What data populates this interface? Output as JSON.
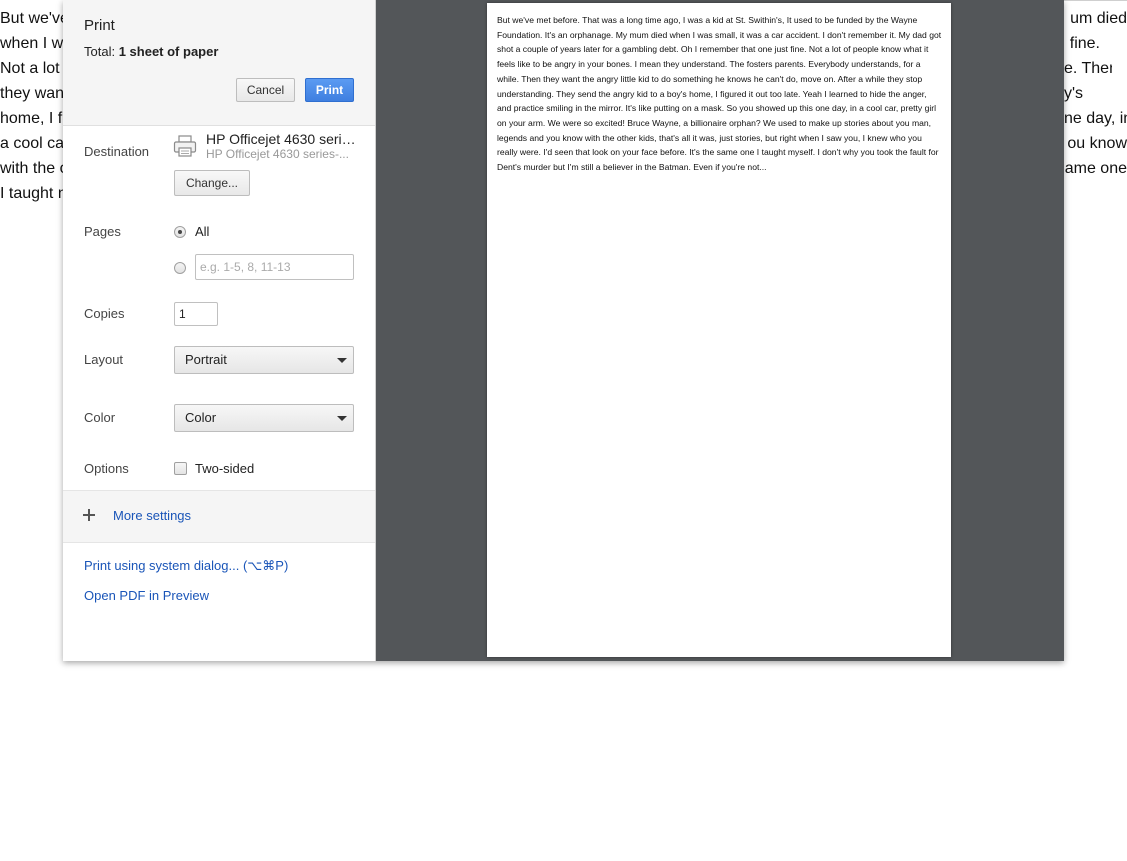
{
  "background_page": {
    "left_lines": [
      "But we've",
      "when I wa",
      "Not a lot",
      "they wan",
      "home, I fi",
      "a cool ca",
      "with the o",
      "I taught n"
    ],
    "right_lines": [
      "um died",
      "fine.",
      "e. Then",
      "y's",
      "ne day, in",
      "ou know",
      "ame one",
      ""
    ]
  },
  "dialog": {
    "title": "Print",
    "total_label": "Total:",
    "total_value": "1 sheet of paper",
    "cancel_label": "Cancel",
    "print_label": "Print",
    "destination": {
      "label": "Destination",
      "printer_name": "HP Officejet 4630 serie...",
      "printer_sub": "HP Officejet 4630 series-...",
      "change_label": "Change...",
      "icon": "printer-icon"
    },
    "pages": {
      "label": "Pages",
      "all_label": "All",
      "all_selected": true,
      "custom_placeholder": "e.g. 1-5, 8, 11-13"
    },
    "copies": {
      "label": "Copies",
      "value": "1"
    },
    "layout": {
      "label": "Layout",
      "selected": "Portrait"
    },
    "color": {
      "label": "Color",
      "selected": "Color"
    },
    "options": {
      "label": "Options",
      "two_sided_label": "Two-sided",
      "two_sided_checked": false
    },
    "more_settings_label": "More settings",
    "system_dialog_link": "Print using system dialog... (⌥⌘P)",
    "open_pdf_link": "Open PDF in Preview"
  },
  "preview": {
    "text": "But we've met before. That was a long time ago, I was a kid at St. Swithin's, It used to be funded by the Wayne Foundation. It's an orphanage. My mum died when I was small, it was a car accident. I don't remember it. My dad got shot a couple of years later for a gambling debt. Oh I remember that one just fine. Not a lot of people know what it feels like to be angry in your bones. I mean they understand. The fosters parents. Everybody understands, for a while. Then they want the angry little kid to do something he knows he can't do, move on. After a while they stop understanding. They send the angry kid to a boy's home, I figured it out too late. Yeah I learned to hide the anger, and practice smiling in the mirror. It's like putting on a mask. So you showed up this one day, in a cool car, pretty girl on your arm. We were so excited! Bruce Wayne, a billionaire orphan? We used to make up stories about you man, legends and you know with the other kids, that's all it was, just stories, but right when I saw you, I knew who you really were. I'd seen that look on your face before. It's the same one I taught myself. I don't why you took the fault for Dent's murder but I'm still a believer in the Batman. Even if you're not..."
  },
  "colors": {
    "accent": "#4285f4",
    "link": "#1a55b8",
    "preview_bg": "#535659"
  }
}
